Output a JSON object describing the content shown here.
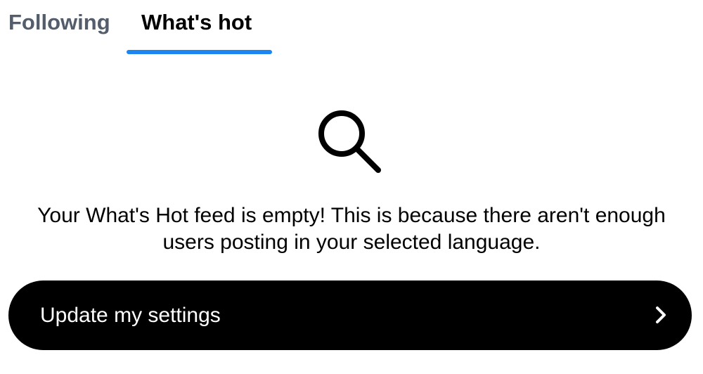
{
  "tabs": {
    "items": [
      {
        "label": "Following",
        "selected": false
      },
      {
        "label": "What's hot",
        "selected": true
      }
    ],
    "accent_color": "#1d85f0",
    "inactive_color": "#545d6b"
  },
  "empty_state": {
    "icon": "search-icon",
    "message": "Your What's Hot feed is empty! This is because there aren't enough users posting in your selected language."
  },
  "cta": {
    "label": "Update my settings",
    "icon": "chevron-right-icon",
    "background": "#000000",
    "text_color": "#ffffff"
  }
}
